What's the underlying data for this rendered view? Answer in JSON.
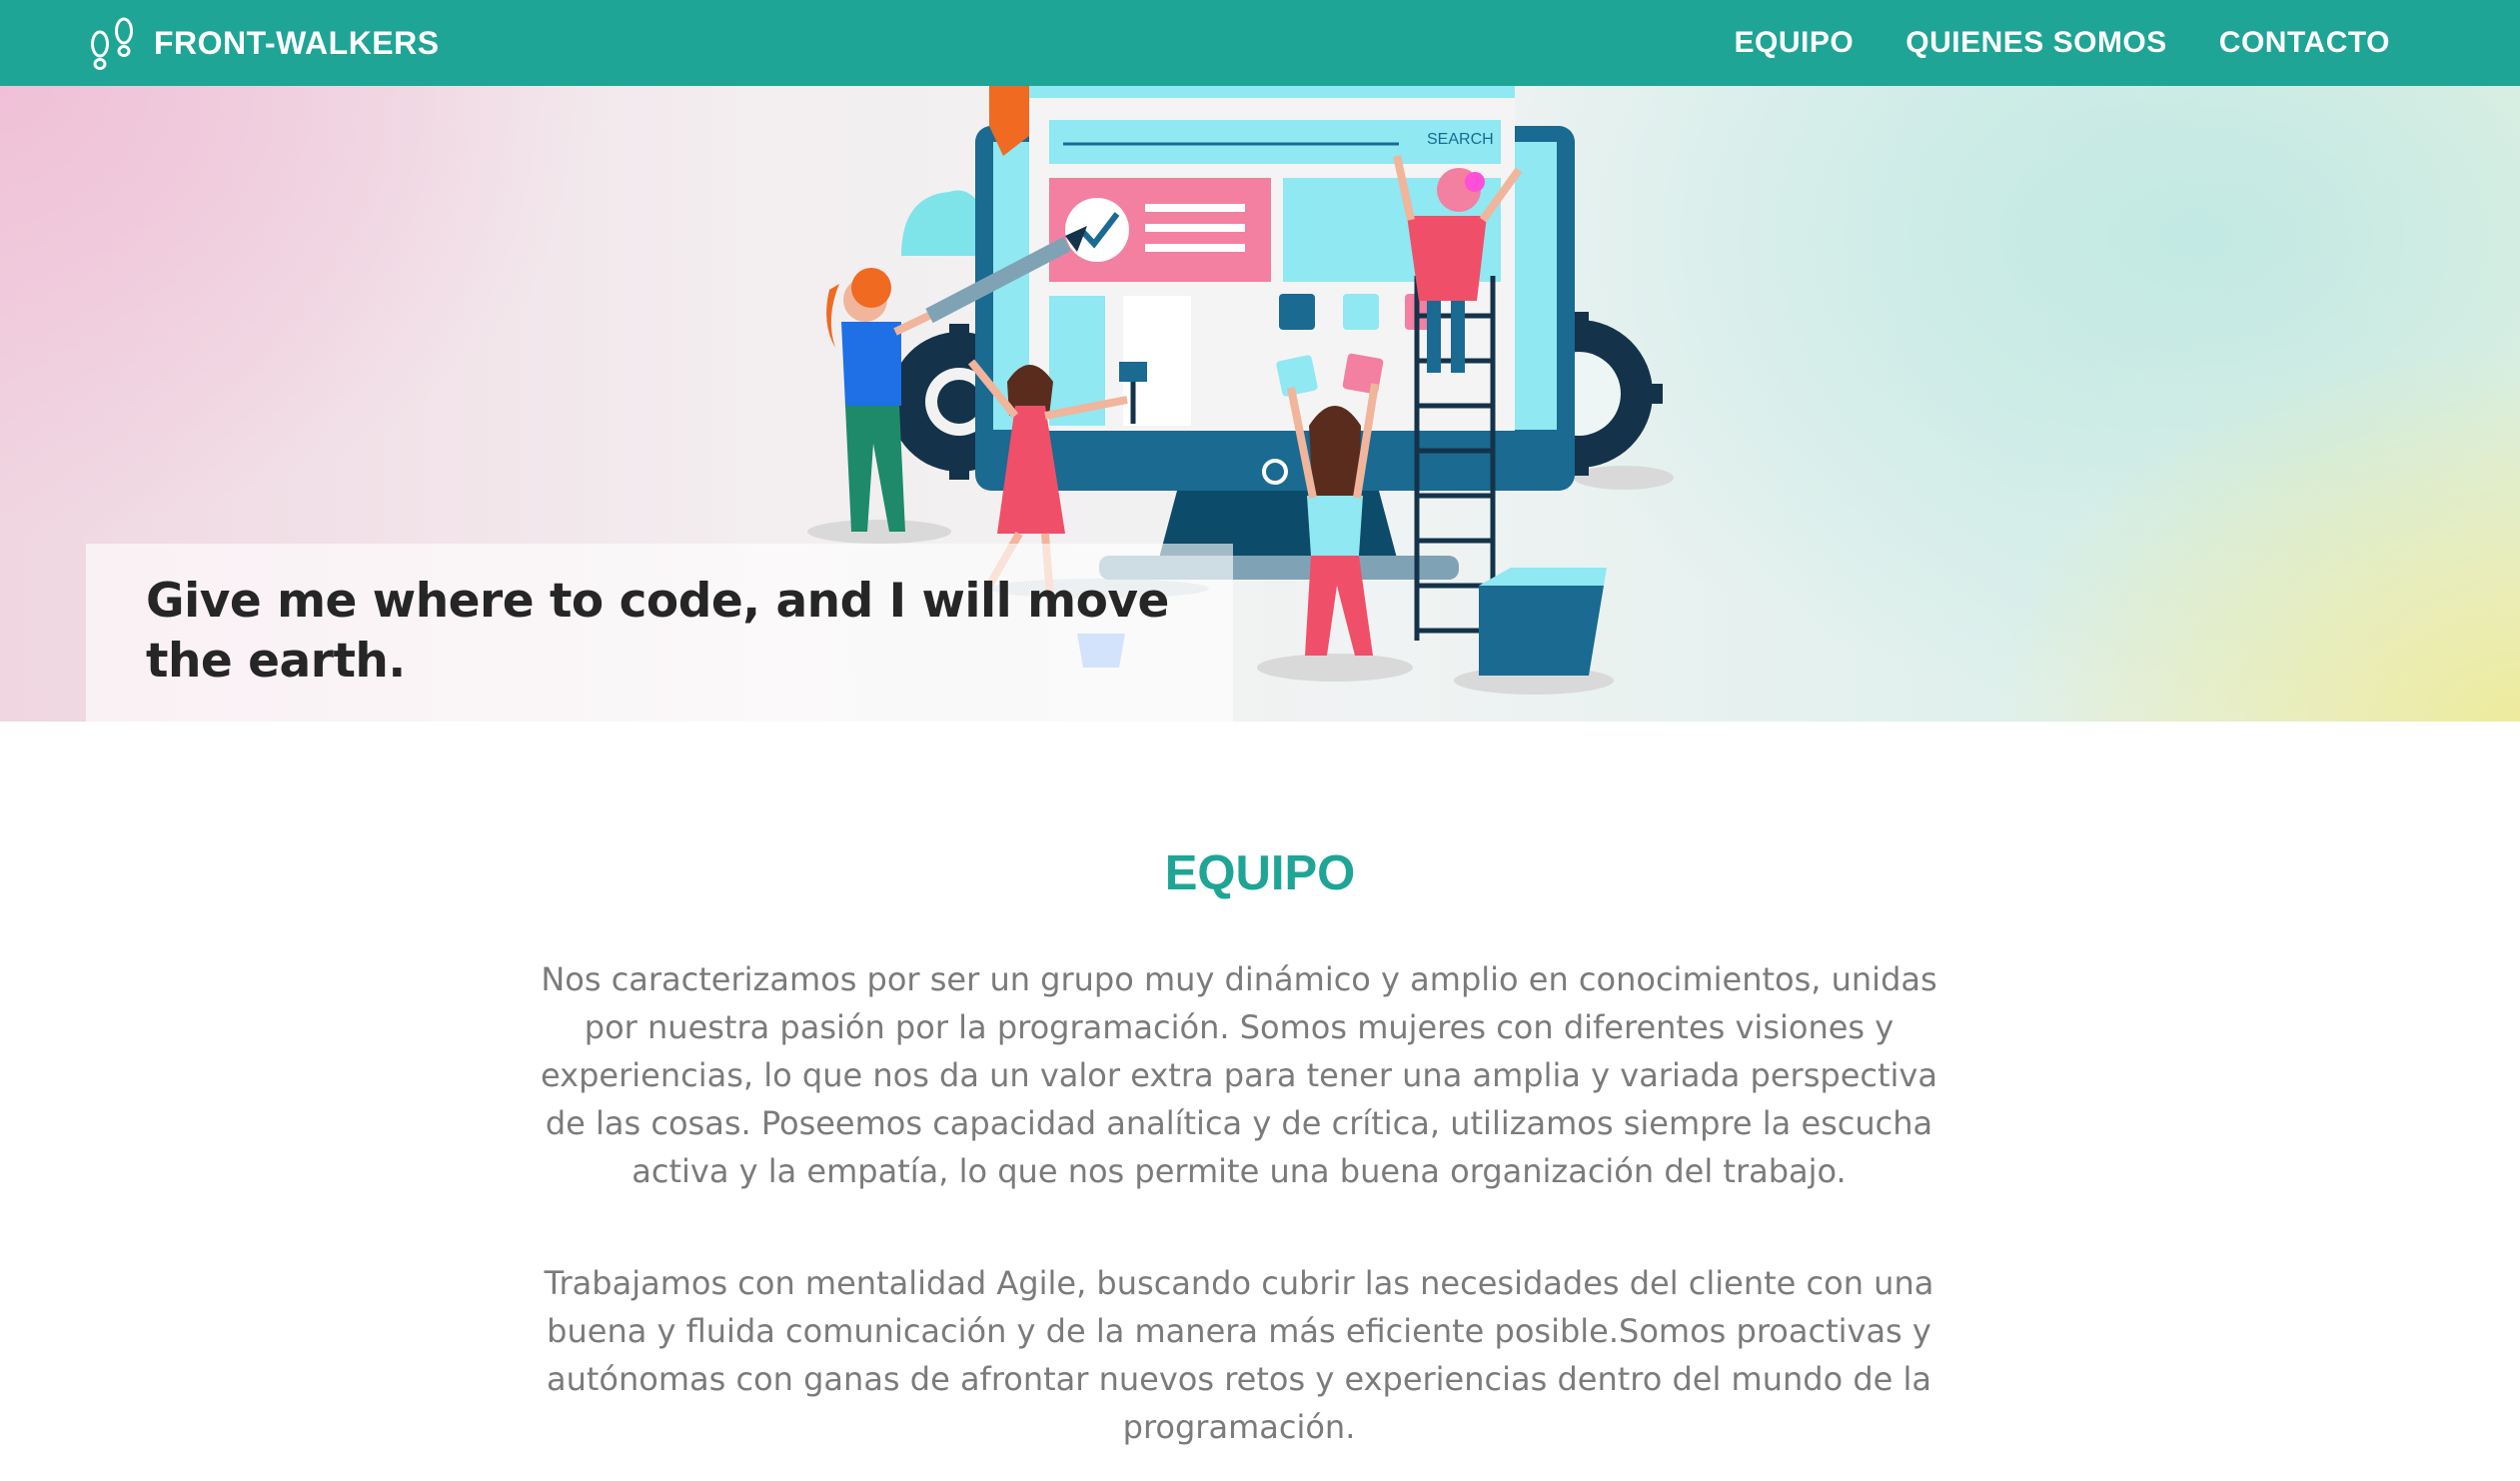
{
  "navbar": {
    "brand": "FRONT-WALKERS",
    "brand_icon": "footprints-icon",
    "links": [
      "EQUIPO",
      "QUIENES SOMOS",
      "CONTACTO"
    ],
    "bg_color": "#1ea595"
  },
  "hero": {
    "tagline": "Give me where to code, and I will move the earth.",
    "illustration": {
      "search_label": "SEARCH"
    }
  },
  "section": {
    "title": "EQUIPO",
    "paragraphs": [
      "Nos caracterizamos por ser un grupo muy dinámico y amplio en conocimientos, unidas por nuestra pasión por la programación. Somos mujeres con diferentes visiones y experiencias, lo que nos da un valor extra para tener una amplia y variada perspectiva de las cosas. Poseemos capacidad analítica y de crítica, utilizamos siempre la escucha activa y la empatía, lo que nos permite una buena organización del trabajo.",
      "Trabajamos con mentalidad Agile, buscando cubrir las necesidades del cliente con una buena y fluida comunicación y de la manera más eficiente posible.Somos proactivas y autónomas con ganas de afrontar nuevos retos y experiencias dentro del mundo de la programación."
    ]
  },
  "colors": {
    "accent": "#1ea595",
    "body_text": "#7b7b7b",
    "tagline_text": "#262626"
  }
}
